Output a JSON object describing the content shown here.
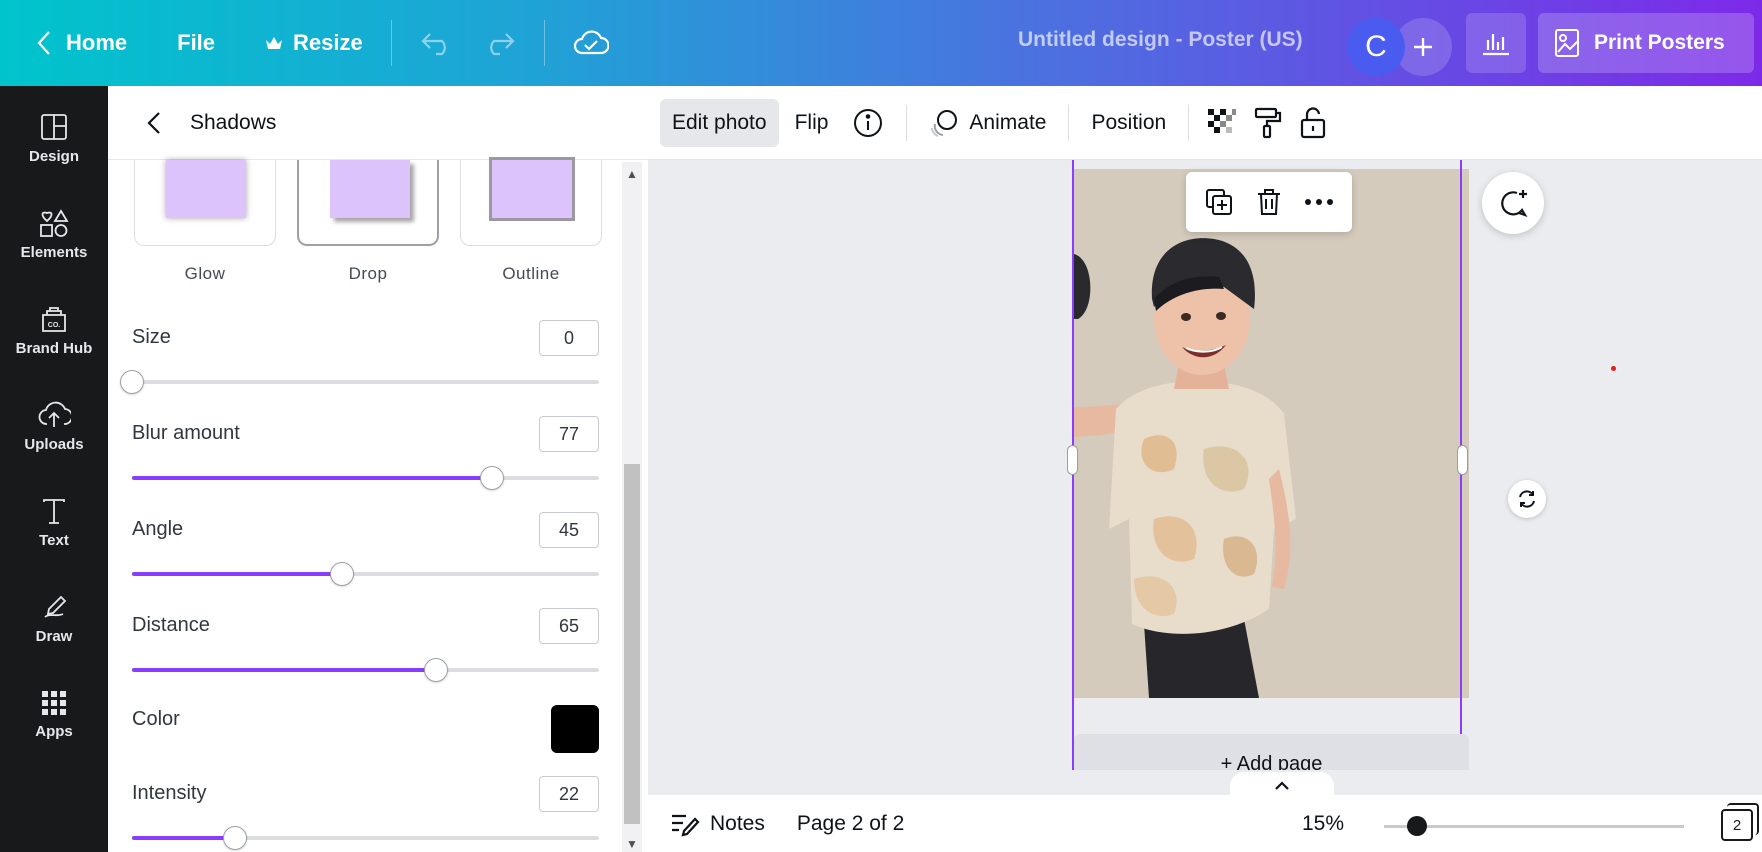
{
  "topbar": {
    "home_label": "Home",
    "file_label": "File",
    "resize_label": "Resize",
    "doc_title": "Untitled design - Poster (US)",
    "avatar_initial": "C",
    "print_label": "Print Posters"
  },
  "rail": {
    "items": [
      {
        "label": "Design",
        "icon": "layout-icon"
      },
      {
        "label": "Elements",
        "icon": "shapes-icon"
      },
      {
        "label": "Brand Hub",
        "icon": "brand-icon"
      },
      {
        "label": "Uploads",
        "icon": "cloud-upload-icon"
      },
      {
        "label": "Text",
        "icon": "text-icon"
      },
      {
        "label": "Draw",
        "icon": "pen-icon"
      },
      {
        "label": "Apps",
        "icon": "grid-icon"
      }
    ]
  },
  "panel": {
    "title": "Shadows",
    "presets": [
      {
        "label": "Glow",
        "selected": false
      },
      {
        "label": "Drop",
        "selected": true
      },
      {
        "label": "Outline",
        "selected": false
      }
    ],
    "controls": {
      "size": {
        "label": "Size",
        "value": "0"
      },
      "blur": {
        "label": "Blur amount",
        "value": "77"
      },
      "angle": {
        "label": "Angle",
        "value": "45"
      },
      "distance": {
        "label": "Distance",
        "value": "65"
      },
      "color": {
        "label": "Color",
        "value": "#000000"
      },
      "intensity": {
        "label": "Intensity",
        "value": "22"
      }
    }
  },
  "context_toolbar": {
    "edit_photo": "Edit photo",
    "flip": "Flip",
    "animate": "Animate",
    "position": "Position"
  },
  "canvas": {
    "add_page": "+ Add page"
  },
  "footer": {
    "notes": "Notes",
    "page_indicator": "Page 2 of 2",
    "zoom": "15%",
    "page_count": "2"
  },
  "colors": {
    "accent": "#8b3dff",
    "rail_bg": "#18191b",
    "preset_fill": "#dcc3fb"
  }
}
